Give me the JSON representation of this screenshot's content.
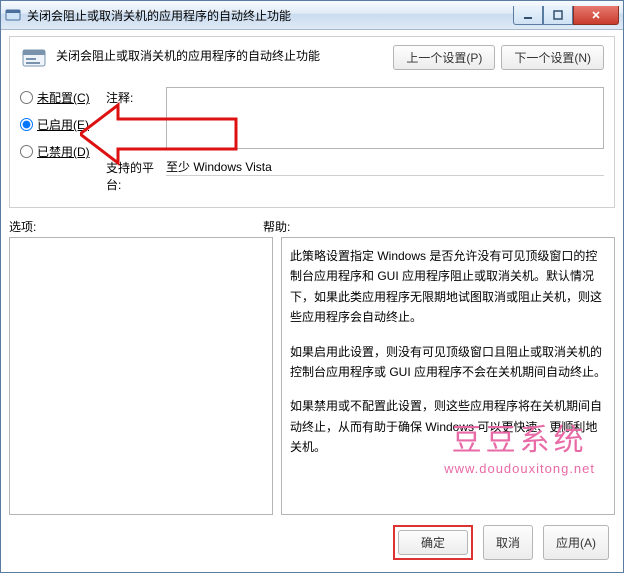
{
  "window": {
    "title": "关闭会阻止或取消关机的应用程序的自动终止功能"
  },
  "header": {
    "title": "关闭会阻止或取消关机的应用程序的自动终止功能",
    "prev_btn": "上一个设置(P)",
    "next_btn": "下一个设置(N)"
  },
  "radios": {
    "not_configured": "未配置(C)",
    "enabled": "已启用(E)",
    "disabled": "已禁用(D)",
    "selected": "enabled"
  },
  "labels": {
    "comment": "注释:",
    "platform": "支持的平台:",
    "options": "选项:",
    "help": "帮助:"
  },
  "values": {
    "comment": "",
    "platform": "至少 Windows Vista"
  },
  "help": {
    "p1": "此策略设置指定 Windows 是否允许没有可见顶级窗口的控制台应用程序和 GUI 应用程序阻止或取消关机。默认情况下，如果此类应用程序无限期地试图取消或阻止关机，则这些应用程序会自动终止。",
    "p2": "如果启用此设置，则没有可见顶级窗口且阻止或取消关机的控制台应用程序或 GUI 应用程序不会在关机期间自动终止。",
    "p3": "如果禁用或不配置此设置，则这些应用程序将在关机期间自动终止，从而有助于确保 Windows 可以更快速、更顺利地关机。"
  },
  "footer": {
    "ok": "确定",
    "cancel": "取消",
    "apply": "应用(A)"
  },
  "watermark": {
    "cn": "豆豆系统",
    "url": "www.doudouxitong.net"
  }
}
